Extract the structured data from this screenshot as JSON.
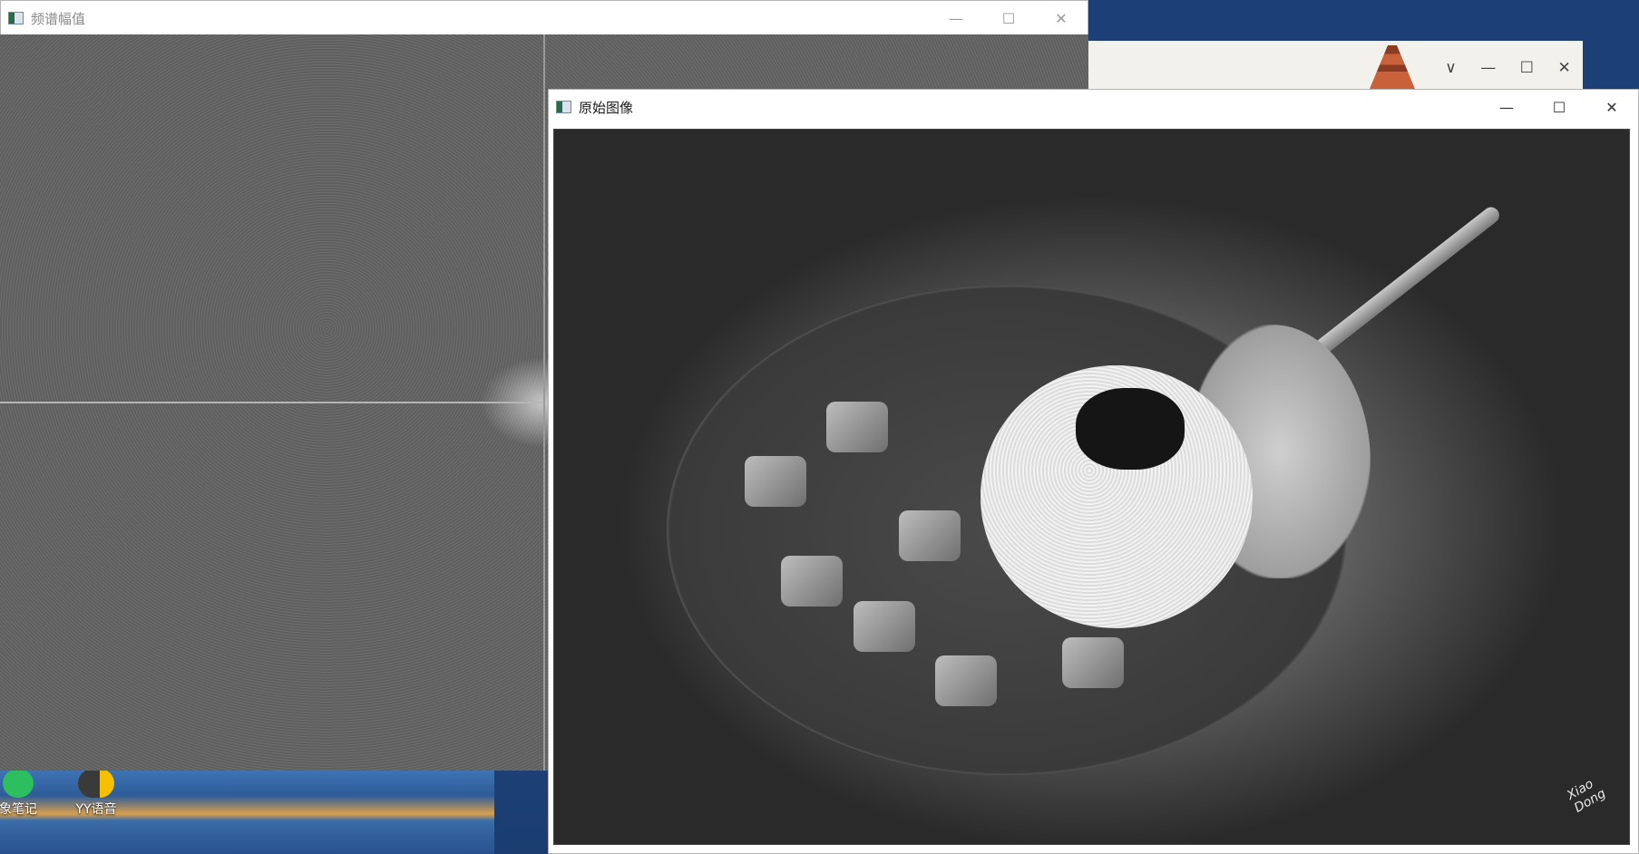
{
  "spectrum_window": {
    "title": "频谱幅值",
    "minimize_icon": "minimize-icon",
    "maximize_icon": "maximize-icon",
    "close_icon": "close-icon"
  },
  "original_window": {
    "title": "原始图像",
    "minimize_icon": "minimize-icon",
    "maximize_icon": "maximize-icon",
    "close_icon": "close-icon",
    "photo_signature": "Xiao Dong"
  },
  "background_window": {
    "dropdown_icon": "chevron-down-icon",
    "minimize_icon": "minimize-icon",
    "maximize_icon": "maximize-icon",
    "close_icon": "close-icon"
  },
  "desktop": {
    "icons": [
      {
        "label": "象笔记",
        "icon": "evernote-icon"
      },
      {
        "label": "YY语音",
        "icon": "yy-voice-icon"
      }
    ]
  },
  "glyphs": {
    "minimize": "—",
    "maximize": "☐",
    "close": "✕",
    "chevron": "∨"
  }
}
